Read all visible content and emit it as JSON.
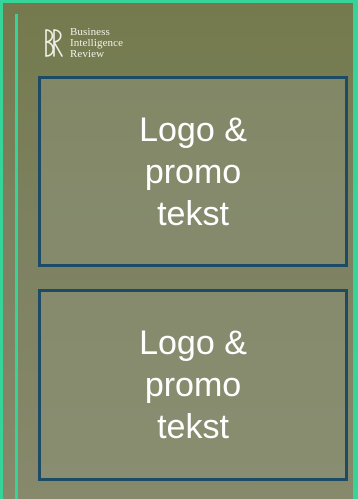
{
  "brand": {
    "line1": "Business",
    "line2": "Intelligence",
    "line3": "Review",
    "icon": "br-monogram-icon"
  },
  "promo_slots": [
    {
      "text": "Logo &\npromo\ntekst"
    },
    {
      "text": "Logo &\npromo\ntekst"
    }
  ],
  "colors": {
    "accent": "#37d49a",
    "box_border": "#1d4b66",
    "background_top": "#747a4c",
    "background_bottom": "#86896b",
    "text": "#ffffff"
  }
}
